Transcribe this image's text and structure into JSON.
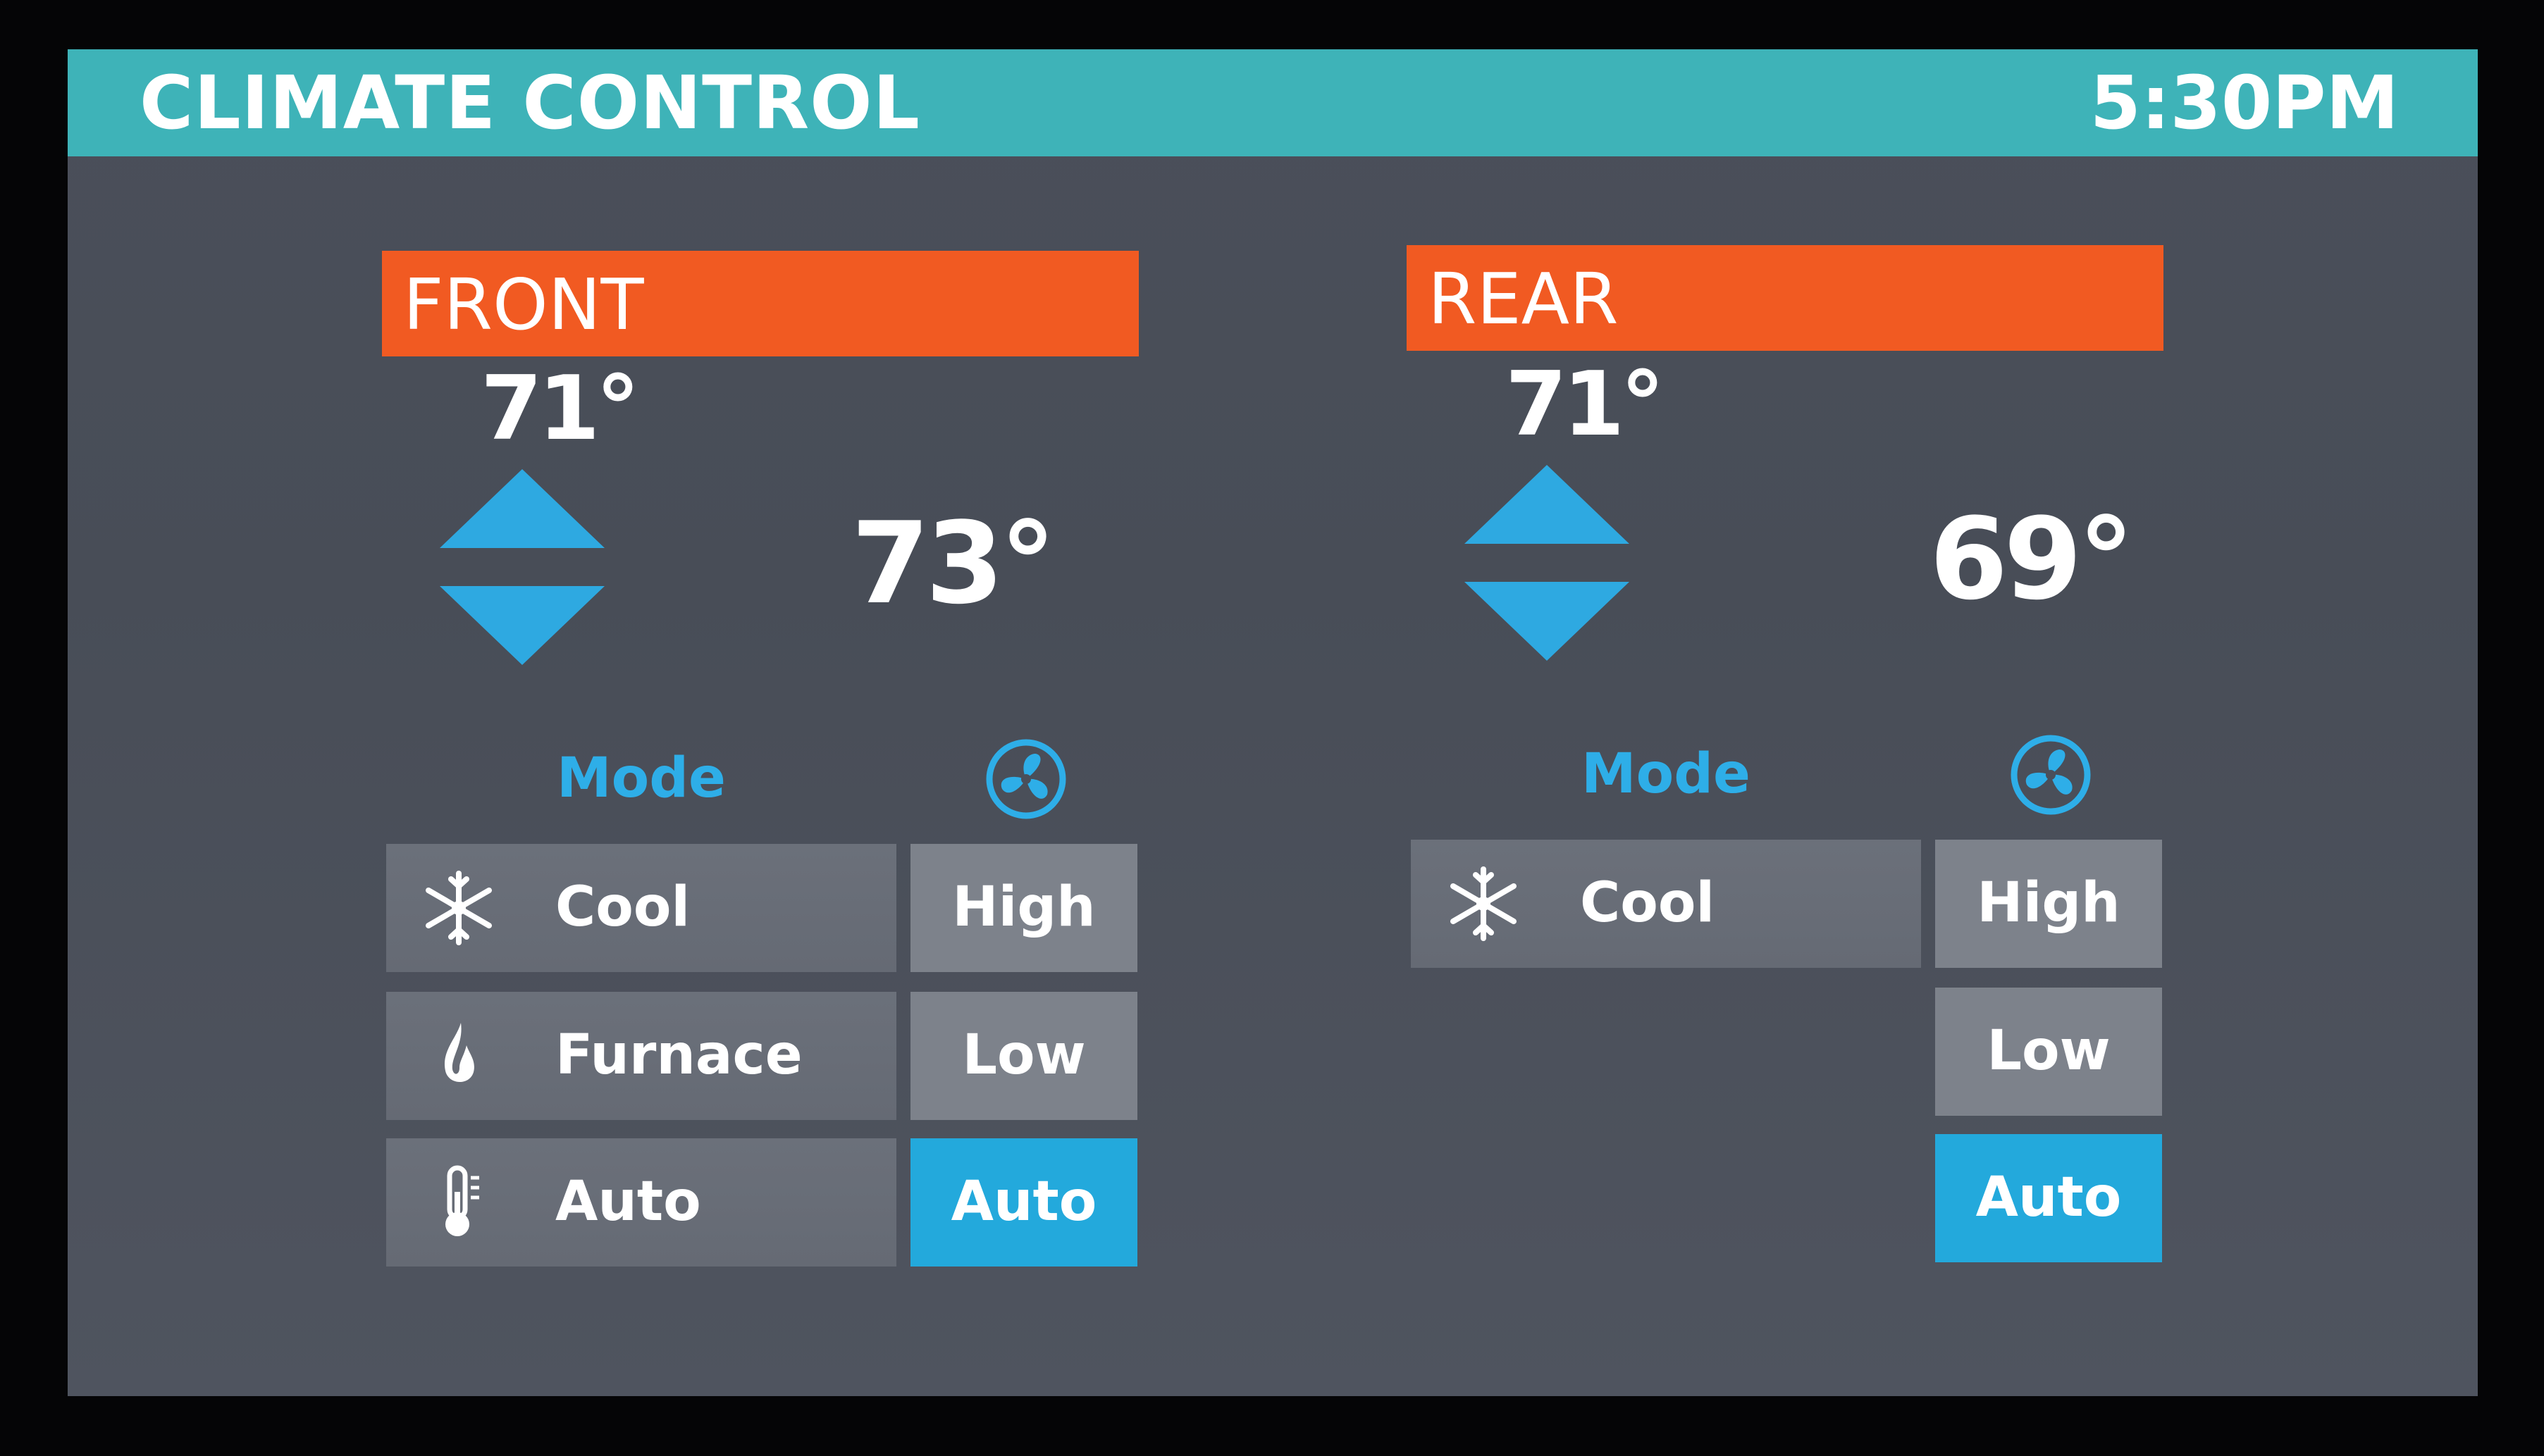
{
  "header": {
    "title": "CLIMATE CONTROL",
    "time": "5:30PM"
  },
  "zones": {
    "front": {
      "label": "FRONT",
      "current_temp": "71°",
      "setpoint_temp": "73°",
      "mode_title": "Mode",
      "modes": [
        {
          "label": "Cool",
          "icon": "snowflake-icon"
        },
        {
          "label": "Furnace",
          "icon": "flame-icon"
        },
        {
          "label": "Auto",
          "icon": "thermometer-icon"
        }
      ],
      "fan_speeds": [
        {
          "label": "High",
          "active": false
        },
        {
          "label": "Low",
          "active": false
        },
        {
          "label": "Auto",
          "active": true
        }
      ]
    },
    "rear": {
      "label": "REAR",
      "current_temp": "71°",
      "setpoint_temp": "69°",
      "mode_title": "Mode",
      "modes": [
        {
          "label": "Cool",
          "icon": "snowflake-icon"
        }
      ],
      "fan_speeds": [
        {
          "label": "High",
          "active": false
        },
        {
          "label": "Low",
          "active": false
        },
        {
          "label": "Auto",
          "active": true
        }
      ]
    }
  },
  "colors": {
    "header": "#3eb3b8",
    "zone_bar": "#f15a22",
    "accent_blue": "#23a9dc",
    "mode_text": "#2eaee8",
    "button": "#6b707a",
    "fan_button": "#7d828b",
    "screen_bg": "#4a4f5a"
  }
}
